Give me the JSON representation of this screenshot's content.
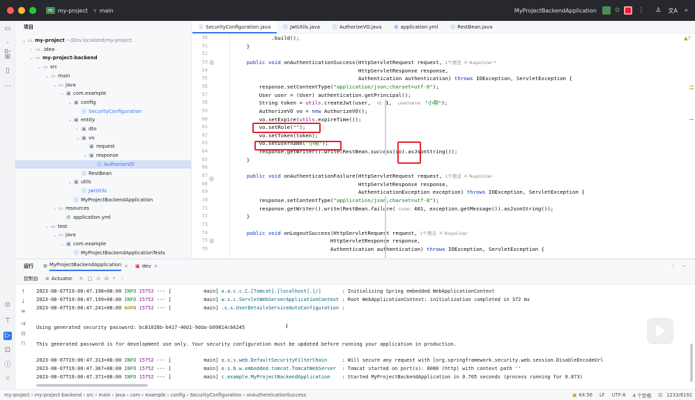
{
  "titlebar": {
    "project": "my-project",
    "branch": "main",
    "run_config": "MyProjectBackendApplication"
  },
  "sidebar": {
    "header": "项目",
    "tree": [
      {
        "label": "my-project",
        "extra": "~/Dev.localized/my-project",
        "depth": 0,
        "icon": "folder",
        "arrow": "down"
      },
      {
        "label": ".idea",
        "depth": 1,
        "icon": "folder",
        "arrow": "right"
      },
      {
        "label": "my-project-backend",
        "depth": 1,
        "icon": "folder",
        "arrow": "down"
      },
      {
        "label": "src",
        "depth": 2,
        "icon": "folder",
        "arrow": "down"
      },
      {
        "label": "main",
        "depth": 3,
        "icon": "folder",
        "arrow": "down"
      },
      {
        "label": "java",
        "depth": 4,
        "icon": "folder",
        "arrow": "down"
      },
      {
        "label": "com.example",
        "depth": 5,
        "icon": "package",
        "arrow": "down"
      },
      {
        "label": "config",
        "depth": 6,
        "icon": "package",
        "arrow": "down"
      },
      {
        "label": "SecurityConfiguration",
        "depth": 7,
        "icon": "class",
        "arrow": ""
      },
      {
        "label": "entity",
        "depth": 6,
        "icon": "package",
        "arrow": "down"
      },
      {
        "label": "dto",
        "depth": 7,
        "icon": "package",
        "arrow": "right"
      },
      {
        "label": "vo",
        "depth": 7,
        "icon": "package",
        "arrow": "down"
      },
      {
        "label": "request",
        "depth": 8,
        "icon": "package",
        "arrow": ""
      },
      {
        "label": "response",
        "depth": 8,
        "icon": "package",
        "arrow": "down"
      },
      {
        "label": "AuthorizeVO",
        "depth": 9,
        "icon": "class",
        "arrow": "",
        "selected": true
      },
      {
        "label": "RestBean",
        "depth": 7,
        "icon": "class",
        "arrow": ""
      },
      {
        "label": "utils",
        "depth": 6,
        "icon": "package",
        "arrow": "down"
      },
      {
        "label": "JwtUtils",
        "depth": 7,
        "icon": "class",
        "arrow": ""
      },
      {
        "label": "MyProjectBackendApplication",
        "depth": 6,
        "icon": "class",
        "arrow": ""
      },
      {
        "label": "resources",
        "depth": 4,
        "icon": "folder",
        "arrow": "down"
      },
      {
        "label": "application.yml",
        "depth": 5,
        "icon": "yml",
        "arrow": ""
      },
      {
        "label": "test",
        "depth": 3,
        "icon": "folder",
        "arrow": "down"
      },
      {
        "label": "java",
        "depth": 4,
        "icon": "folder",
        "arrow": "down"
      },
      {
        "label": "com.example",
        "depth": 5,
        "icon": "package",
        "arrow": "down"
      },
      {
        "label": "MyProjectBackendApplicationTests",
        "depth": 6,
        "icon": "class",
        "arrow": ""
      }
    ]
  },
  "tabs": [
    {
      "label": "SecurityConfiguration.java",
      "active": true
    },
    {
      "label": "JwtUtils.java"
    },
    {
      "label": "AuthorizeVO.java"
    },
    {
      "label": "application.yml"
    },
    {
      "label": "RestBean.java"
    }
  ],
  "editor": {
    "warnings": "▲7",
    "lines": [
      {
        "n": "50",
        "html": "                <span>.build();</span>"
      },
      {
        "n": "51",
        "text": "    }"
      },
      {
        "n": "52",
        "text": ""
      },
      {
        "n": "53",
        "text": "    public void onAuthenticationSuccess(HttpServletRequest request,",
        "hint": "  1个用法  ≗ NagoColer *"
      },
      {
        "n": "54",
        "text": "                                        HttpServletResponse response,"
      },
      {
        "n": "55",
        "text": "                                        Authentication authentication) throws IOException, ServletException {"
      },
      {
        "n": "56",
        "text": "        response.setContentType(\"application/json;charset=utf-8\");"
      },
      {
        "n": "57",
        "text": "        User user = (User) authentication.getPrincipal();"
      },
      {
        "n": "58",
        "text": "        String token = utils.createJwt(user,  id: 1,  username: \"小明\");"
      },
      {
        "n": "59",
        "text": "        AuthorizeVO vo = new AuthorizeVO();"
      },
      {
        "n": "60",
        "text": "        vo.setExpire(utils.expireTime());"
      },
      {
        "n": "61",
        "text": "        vo.setRole(\"\");"
      },
      {
        "n": "62",
        "text": "        vo.setToken(token);"
      },
      {
        "n": "63",
        "text": "        vo.setUsername(\"小明\");"
      },
      {
        "n": "64",
        "text": "        response.getWriter().write(RestBean.success(vo).asJsonString());"
      },
      {
        "n": "65",
        "text": "    }"
      },
      {
        "n": "66",
        "text": ""
      },
      {
        "n": "67",
        "text": "    public void onAuthenticationFailure(HttpServletRequest request,",
        "hint": "  1个用法  ≗ NagoColer"
      },
      {
        "n": "68",
        "text": "                                        HttpServletResponse response,"
      },
      {
        "n": "69",
        "text": "                                        AuthenticationException exception) throws IOException, ServletException {"
      },
      {
        "n": "70",
        "text": "        response.setContentType(\"application/json;charset=utf-8\");"
      },
      {
        "n": "71",
        "text": "        response.getWriter().write(RestBean.failure( code: 401, exception.getMessage()).asJsonString());"
      },
      {
        "n": "72",
        "text": "    }"
      },
      {
        "n": "73",
        "text": ""
      },
      {
        "n": "74",
        "text": "    public void onLogoutSuccess(HttpServletRequest request,",
        "hint": "  1个用法  ≗ NagoColer"
      },
      {
        "n": "75",
        "text": "                               HttpServletResponse response,"
      },
      {
        "n": "76",
        "text": "                               Authentication authentication) throws IOException, ServletException {"
      }
    ]
  },
  "run": {
    "tab_label": "运行",
    "config_tab": "MyProjectBackendApplication",
    "dev_tab": "dev",
    "console_label": "控制台",
    "actuator_label": "Actuator",
    "log": [
      {
        "ts": "2023-08-07T19:00:47.198+08:00",
        "level": "INFO",
        "pid": "15752",
        "sep": "---",
        "thread": "[           main]",
        "logger": "o.a.c.c.C.[Tomcat].[localhost].[/]      ",
        "msg": " : Initializing Spring embedded WebApplicationContext"
      },
      {
        "ts": "2023-08-07T19:00:47.199+08:00",
        "level": "INFO",
        "pid": "15752",
        "sep": "---",
        "thread": "[           main]",
        "logger": "w.s.c.ServletWebServerApplicationContext",
        "msg": " : Root WebApplicationContext: initialization completed in 372 ms"
      },
      {
        "ts": "2023-08-07T19:00:47.241+08:00",
        "level": "WARN",
        "pid": "15752",
        "sep": "---",
        "thread": "[           main]",
        "logger": ".s.s.UserDetailsServiceAutoConfiguration ",
        "msg": ":"
      }
    ],
    "password_line": "Using generated security password: bc81028b-b417-40d1-9dda-b09814c66245",
    "dev_note": "This generated password is for development use only. Your security configuration must be updated before running your application in production.",
    "log2": [
      {
        "ts": "2023-08-07T19:00:47.313+08:00",
        "level": "INFO",
        "pid": "15752",
        "sep": "---",
        "thread": "[           main]",
        "logger": "o.s.s.web.DefaultSecurityFilterChain    ",
        "msg": " : Will secure any request with [org.springframework.security.web.session.DisableEncodeUrl"
      },
      {
        "ts": "2023-08-07T19:00:47.367+08:00",
        "level": "INFO",
        "pid": "15752",
        "sep": "---",
        "thread": "[           main]",
        "logger": "o.s.b.w.embedded.tomcat.TomcatWebServer ",
        "msg": " : Tomcat started on port(s): 8080 (http) with context path ''"
      },
      {
        "ts": "2023-08-07T19:00:47.371+08:00",
        "level": "INFO",
        "pid": "15752",
        "sep": "---",
        "thread": "[           main]",
        "logger": "c.example.MyProjectBackendApplication   ",
        "msg": " : Started MyProjectBackendApplication in 0.705 seconds (process running for 0.873)"
      }
    ]
  },
  "status": {
    "breadcrumb": [
      "my-project",
      "my-project-backend",
      "src",
      "main",
      "java",
      "com",
      "example",
      "config",
      "SecurityConfiguration",
      "onAuthenticationSuccess"
    ],
    "position": "64:56",
    "line_sep": "LF",
    "encoding": "UTF-8",
    "indent": "4 个空格",
    "memory": "1233/8192"
  }
}
